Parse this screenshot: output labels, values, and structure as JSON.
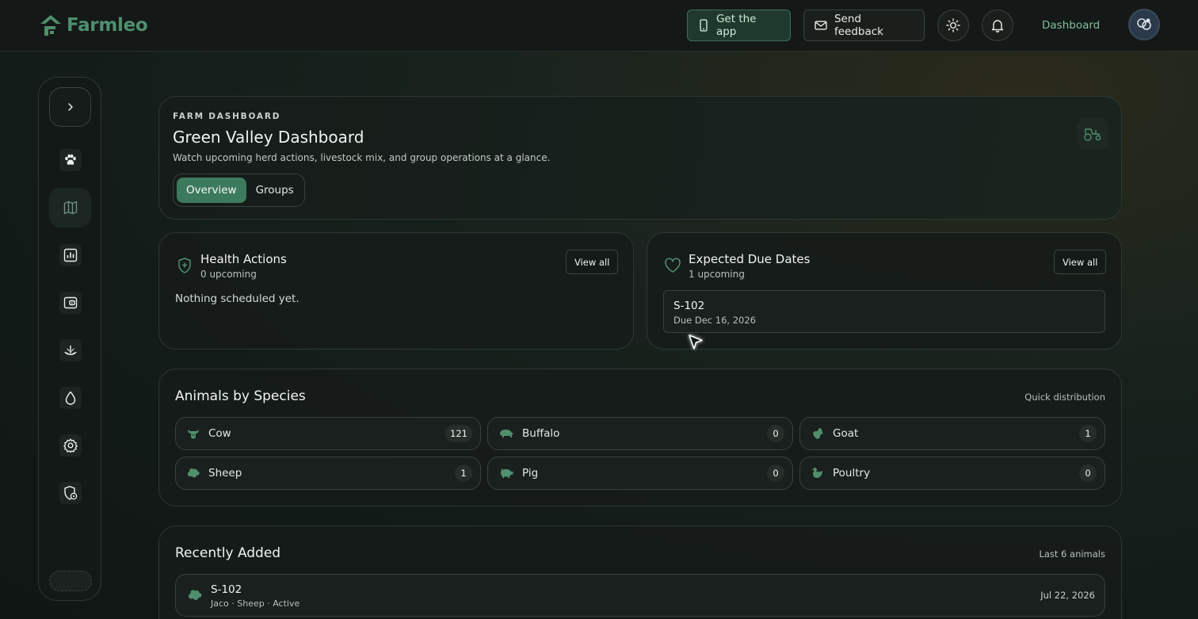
{
  "brand": {
    "name": "Farmleo",
    "color": "#4f8f6e"
  },
  "topbar": {
    "get_app": "Get the app",
    "send_feedback": "Send feedback",
    "theme_icon": "sun-icon",
    "notifications_icon": "bell-icon",
    "nav_link": "Dashboard"
  },
  "sidebar": {
    "items": [
      {
        "name": "paw-icon"
      },
      {
        "name": "map-icon",
        "active": true
      },
      {
        "name": "chart-icon"
      },
      {
        "name": "wallet-icon"
      },
      {
        "name": "sprout-icon"
      },
      {
        "name": "droplet-icon"
      },
      {
        "name": "gear-icon"
      },
      {
        "name": "shield-settings-icon"
      }
    ]
  },
  "hero": {
    "eyebrow": "FARM DASHBOARD",
    "title": "Green Valley Dashboard",
    "subtitle": "Watch upcoming herd actions, livestock mix, and group operations at a glance.",
    "tabs": [
      {
        "label": "Overview",
        "active": true
      },
      {
        "label": "Groups",
        "active": false
      }
    ]
  },
  "health": {
    "title": "Health Actions",
    "subtitle": "0 upcoming",
    "view_all": "View all",
    "empty": "Nothing scheduled yet."
  },
  "due_dates": {
    "title": "Expected Due Dates",
    "subtitle": "1 upcoming",
    "view_all": "View all",
    "items": [
      {
        "id": "S-102",
        "date": "Due Dec 16, 2026"
      }
    ]
  },
  "species": {
    "title": "Animals by Species",
    "meta": "Quick distribution",
    "items": [
      {
        "name": "Cow",
        "count": "121"
      },
      {
        "name": "Buffalo",
        "count": "0"
      },
      {
        "name": "Goat",
        "count": "1"
      },
      {
        "name": "Sheep",
        "count": "1"
      },
      {
        "name": "Pig",
        "count": "0"
      },
      {
        "name": "Poultry",
        "count": "0"
      }
    ]
  },
  "recent": {
    "title": "Recently Added",
    "meta": "Last 6 animals",
    "items": [
      {
        "id": "S-102",
        "meta": "Jaco · Sheep · Active",
        "date": "Jul 22, 2026"
      }
    ]
  }
}
